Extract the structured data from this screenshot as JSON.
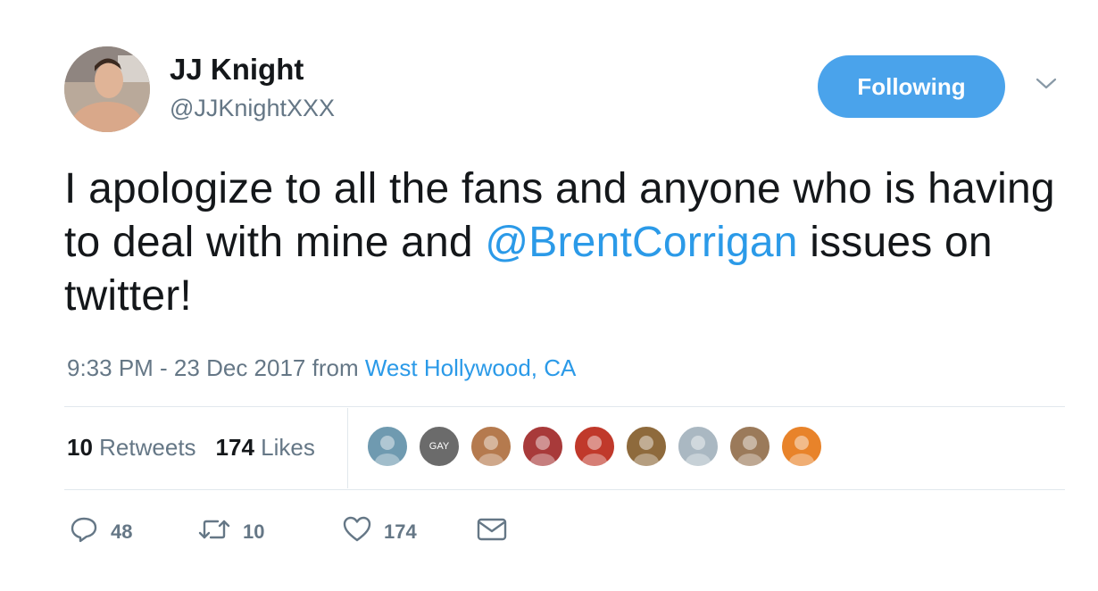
{
  "author": {
    "name": "JJ Knight",
    "handle": "@JJKnightXXX"
  },
  "follow_button": {
    "label": "Following"
  },
  "tweet": {
    "text_before": "I apologize to all the fans and anyone who is having to deal with mine and ",
    "mention": "@BrentCorrigan",
    "text_after": " issues on twitter!"
  },
  "meta": {
    "time": "9:33 PM - 23 Dec 2017",
    "from": "from",
    "location": "West Hollywood, CA"
  },
  "stats": {
    "retweets_count": "10",
    "retweets_label": "Retweets",
    "likes_count": "174",
    "likes_label": "Likes"
  },
  "liker_avatars": [
    {
      "name": "liker-1",
      "color": "#6f9ab0"
    },
    {
      "name": "liker-2",
      "color": "#6b6b6b",
      "text": "GAY"
    },
    {
      "name": "liker-3",
      "color": "#b57a4e"
    },
    {
      "name": "liker-4",
      "color": "#a83a3a"
    },
    {
      "name": "liker-5",
      "color": "#c0392b"
    },
    {
      "name": "liker-6",
      "color": "#8e6a3c"
    },
    {
      "name": "liker-7",
      "color": "#aab8c2"
    },
    {
      "name": "liker-8",
      "color": "#9b7a5a"
    },
    {
      "name": "liker-9",
      "color": "#e8832a"
    }
  ],
  "actions": {
    "reply_count": "48",
    "retweet_count": "10",
    "like_count": "174"
  },
  "colors": {
    "accent": "#2b9ae8",
    "follow_button": "#4aa3eb",
    "secondary_text": "#657786"
  }
}
